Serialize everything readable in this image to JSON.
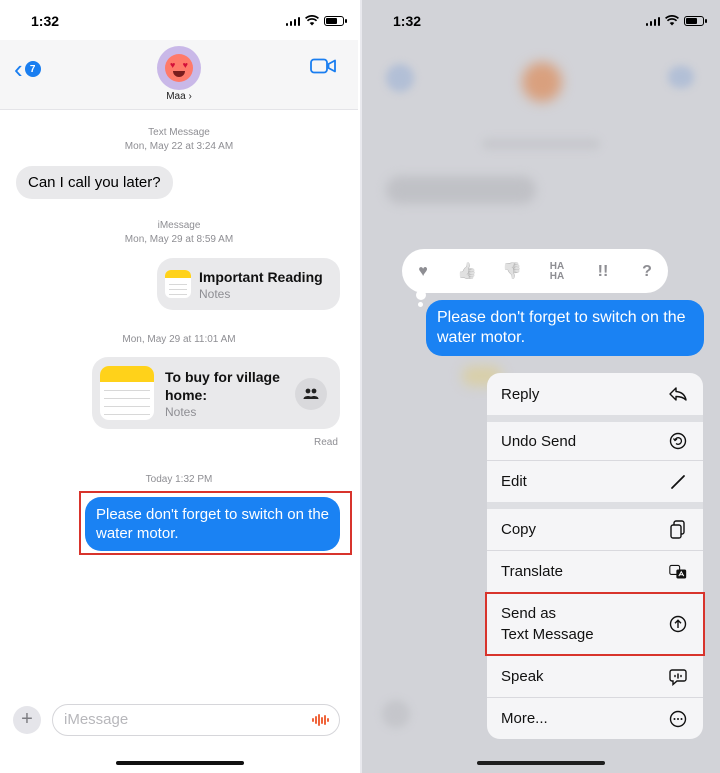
{
  "left": {
    "status_time": "1:32",
    "back_badge": "7",
    "contact_name": "Maa ›",
    "timestamps": {
      "t1_label": "Text Message",
      "t1_date": "Mon, May 22 at 3:24 AM",
      "t2_label": "iMessage",
      "t2_date": "Mon, May 29 at 8:59 AM",
      "t3_date": "Mon, May 29 at 11:01 AM",
      "t4_date": "Today 1:32 PM"
    },
    "messages": {
      "received_text": "Can I call you later?",
      "note1_title": "Important Reading",
      "note1_sub": "Notes",
      "note2_title": "To buy for village home:",
      "note2_sub": "Notes",
      "read_receipt": "Read",
      "sent_text": "Please don't forget to switch on the water motor."
    },
    "input_placeholder": "iMessage"
  },
  "right": {
    "status_time": "1:32",
    "reactions": [
      "♥",
      "👍",
      "👎",
      "HA HA",
      "!!",
      "?"
    ],
    "message_text": "Please don't forget to switch on the water motor.",
    "menu": {
      "reply": "Reply",
      "undo_send": "Undo Send",
      "edit": "Edit",
      "copy": "Copy",
      "translate": "Translate",
      "send_as_line1": "Send as",
      "send_as_line2": "Text Message",
      "speak": "Speak",
      "more": "More..."
    }
  },
  "colors": {
    "imessage_blue": "#1a82f3",
    "highlight_red": "#d8342c",
    "notes_yellow": "#ffd21a"
  }
}
